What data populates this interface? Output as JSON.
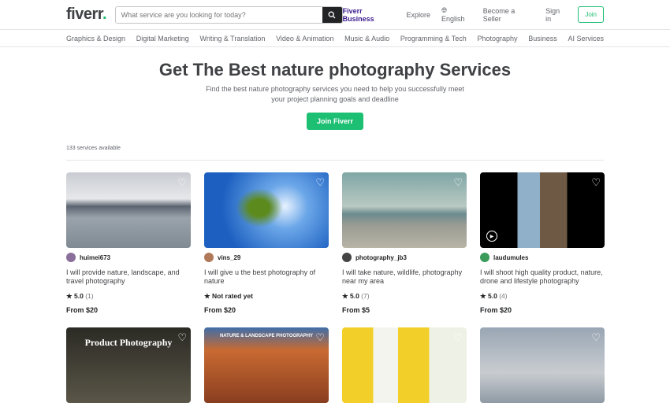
{
  "header": {
    "logo": "fiverr",
    "search_placeholder": "What service are you looking for today?",
    "nav": {
      "business": "Fiverr Business",
      "explore": "Explore",
      "language": "English",
      "seller": "Become a Seller",
      "signin": "Sign in",
      "join": "Join"
    }
  },
  "categories": [
    "Graphics & Design",
    "Digital Marketing",
    "Writing & Translation",
    "Video & Animation",
    "Music & Audio",
    "Programming & Tech",
    "Photography",
    "Business",
    "AI Services"
  ],
  "hero": {
    "title": "Get The Best nature photography Services",
    "subtitle_line1": "Find the best nature photography services you need to help you successfully meet",
    "subtitle_line2": "your project planning goals and deadline",
    "button": "Join Fiverr"
  },
  "services_count": "133 services available",
  "gigs": [
    {
      "seller": "huimei673",
      "title": "I will provide nature, landscape, and travel photography",
      "rating": "5.0",
      "reviews": "(1)",
      "price": "From $20"
    },
    {
      "seller": "vins_29",
      "title": "I will give u the best photography of nature",
      "rating": "Not rated yet",
      "reviews": "",
      "price": "From $20"
    },
    {
      "seller": "photography_jb3",
      "title": "I will take nature, wildlife, photography near my area",
      "rating": "5.0",
      "reviews": "(7)",
      "price": "From $5"
    },
    {
      "seller": "laudumules",
      "title": "I will shoot high quality product, nature, drone and lifestyle photography",
      "rating": "5.0",
      "reviews": "(4)",
      "price": "From $20"
    }
  ],
  "row2_overlays": [
    "Product Photography",
    "NATURE & LANDSCAPE PHOTOGRAPHY"
  ]
}
